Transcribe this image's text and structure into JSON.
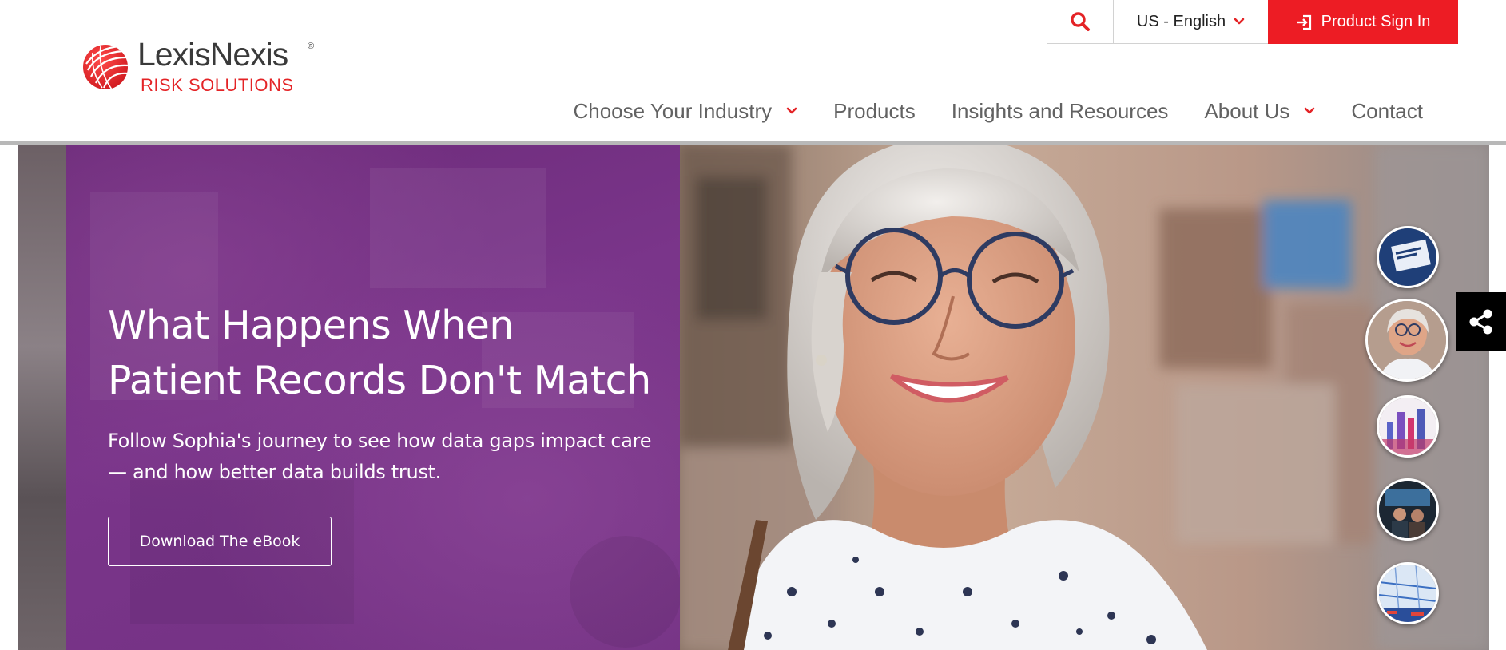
{
  "brand": {
    "name": "LexisNexis",
    "registered": "®",
    "tagline": "RISK SOLUTIONS",
    "accent_color": "#ed1c24"
  },
  "utility": {
    "search_icon": "magnifier-icon",
    "language_label": "US - English",
    "sign_in_label": "Product Sign In",
    "sign_in_icon": "sign-in-arrow-icon"
  },
  "nav": {
    "items": [
      {
        "label": "Choose Your Industry",
        "has_dropdown": true
      },
      {
        "label": "Products",
        "has_dropdown": false
      },
      {
        "label": "Insights and Resources",
        "has_dropdown": false
      },
      {
        "label": "About Us",
        "has_dropdown": true
      },
      {
        "label": "Contact",
        "has_dropdown": false
      }
    ]
  },
  "hero": {
    "title": "What Happens When Patient Records Don't Match",
    "subtitle": "Follow Sophia's journey to see how data gaps impact care — and how better data builds trust.",
    "cta_label": "Download The eBook",
    "panel_color": "#733183"
  },
  "carousel": {
    "slide_count": 5,
    "active_slide": 2
  },
  "share": {
    "icon": "share-icon"
  }
}
